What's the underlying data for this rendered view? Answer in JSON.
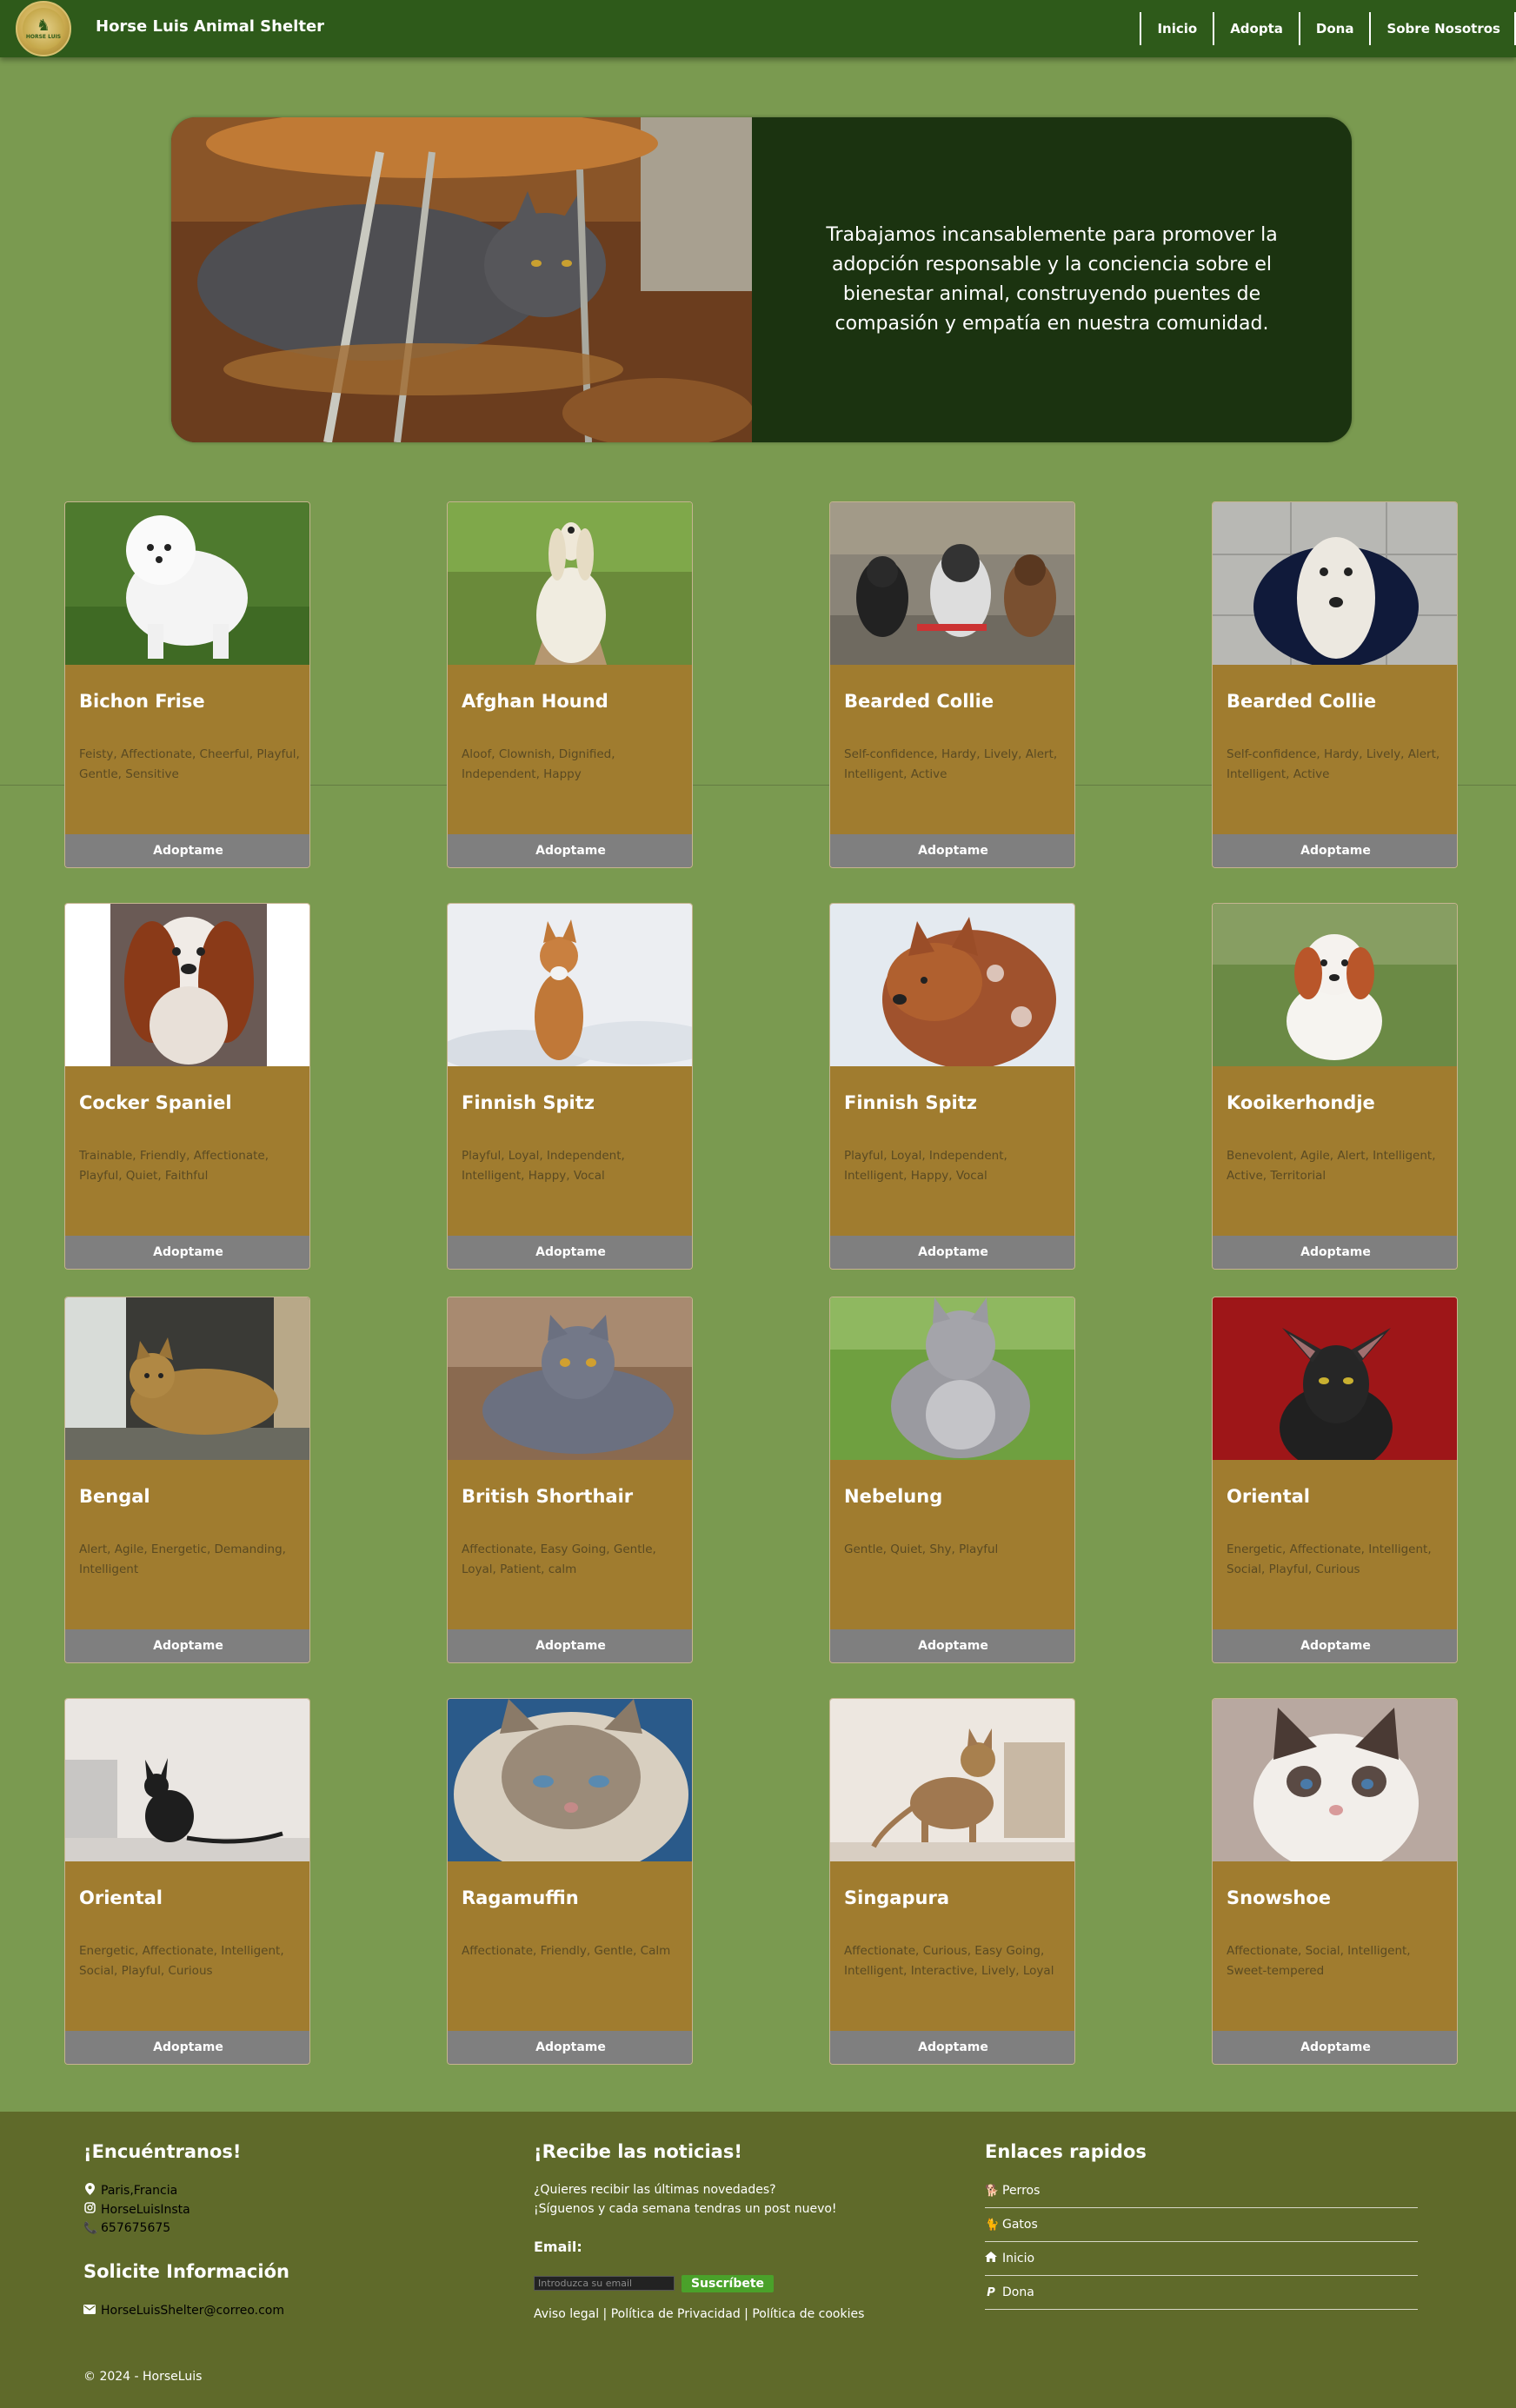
{
  "nav": {
    "brand": "Horse Luis Animal Shelter",
    "logo_text": "HORSE LUIS",
    "links": [
      "Inicio",
      "Adopta",
      "Dona",
      "Sobre Nosotros"
    ]
  },
  "hero": {
    "text": "Trabajamos incansablemente para promover la adopción responsable y la conciencia sobre el bienestar animal, construyendo puentes de compasión y empatía en nuestra comunidad."
  },
  "cards": [
    {
      "name": "Bichon Frise",
      "traits": "Feisty, Affectionate, Cheerful, Playful, Gentle, Sensitive",
      "button": "Adoptame"
    },
    {
      "name": "Afghan Hound",
      "traits": "Aloof, Clownish, Dignified, Independent, Happy",
      "button": "Adoptame"
    },
    {
      "name": "Bearded Collie",
      "traits": "Self-confidence, Hardy, Lively, Alert, Intelligent, Active",
      "button": "Adoptame"
    },
    {
      "name": "Bearded Collie",
      "traits": "Self-confidence, Hardy, Lively, Alert, Intelligent, Active",
      "button": "Adoptame"
    },
    {
      "name": "Cocker Spaniel",
      "traits": "Trainable, Friendly, Affectionate, Playful, Quiet, Faithful",
      "button": "Adoptame"
    },
    {
      "name": "Finnish Spitz",
      "traits": "Playful, Loyal, Independent, Intelligent, Happy, Vocal",
      "button": "Adoptame"
    },
    {
      "name": "Finnish Spitz",
      "traits": "Playful, Loyal, Independent, Intelligent, Happy, Vocal",
      "button": "Adoptame"
    },
    {
      "name": "Kooikerhondje",
      "traits": "Benevolent, Agile, Alert, Intelligent, Active, Territorial",
      "button": "Adoptame"
    },
    {
      "name": "Bengal",
      "traits": "Alert, Agile, Energetic, Demanding, Intelligent",
      "button": "Adoptame"
    },
    {
      "name": "British Shorthair",
      "traits": "Affectionate, Easy Going, Gentle, Loyal, Patient, calm",
      "button": "Adoptame"
    },
    {
      "name": "Nebelung",
      "traits": "Gentle, Quiet, Shy, Playful",
      "button": "Adoptame"
    },
    {
      "name": "Oriental",
      "traits": "Energetic, Affectionate, Intelligent, Social, Playful, Curious",
      "button": "Adoptame"
    },
    {
      "name": "Oriental",
      "traits": "Energetic, Affectionate, Intelligent, Social, Playful, Curious",
      "button": "Adoptame"
    },
    {
      "name": "Ragamuffin",
      "traits": "Affectionate, Friendly, Gentle, Calm",
      "button": "Adoptame"
    },
    {
      "name": "Singapura",
      "traits": "Affectionate, Curious, Easy Going, Intelligent, Interactive, Lively, Loyal",
      "button": "Adoptame"
    },
    {
      "name": "Snowshoe",
      "traits": "Affectionate, Social, Intelligent, Sweet-tempered",
      "button": "Adoptame"
    }
  ],
  "footer": {
    "find_title": "¡Encuéntranos!",
    "location": "Paris,Francia",
    "instagram": "HorseLuisInsta",
    "phone": "657675675",
    "info_title": "Solicite Información",
    "email": "HorseLuisShelter@correo.com",
    "news_title": "¡Recibe las noticias!",
    "news_line1": "¿Quieres recibir las últimas novedades?",
    "news_line2": "¡Síguenos y cada semana tendras un post nuevo!",
    "email_label": "Email:",
    "email_placeholder": "Introduzca su email",
    "subscribe": "Suscríbete",
    "legal": "Aviso legal | Política de Privacidad | Política de cookies",
    "links_title": "Enlaces rapidos",
    "quick_links": [
      "Perros",
      "Gatos",
      "Inicio",
      "Dona"
    ],
    "copyright": "© 2024 - HorseLuis"
  },
  "colors": {
    "page_bg": "#7a9a50",
    "nav_bg": "#2e5a1a",
    "hero_text_bg": "#1b3310",
    "card_bg": "#a07c2f",
    "card_button": "#7f7f7f",
    "footer_bg": "#5f6a2a",
    "subscribe_button": "#4aa12a"
  }
}
